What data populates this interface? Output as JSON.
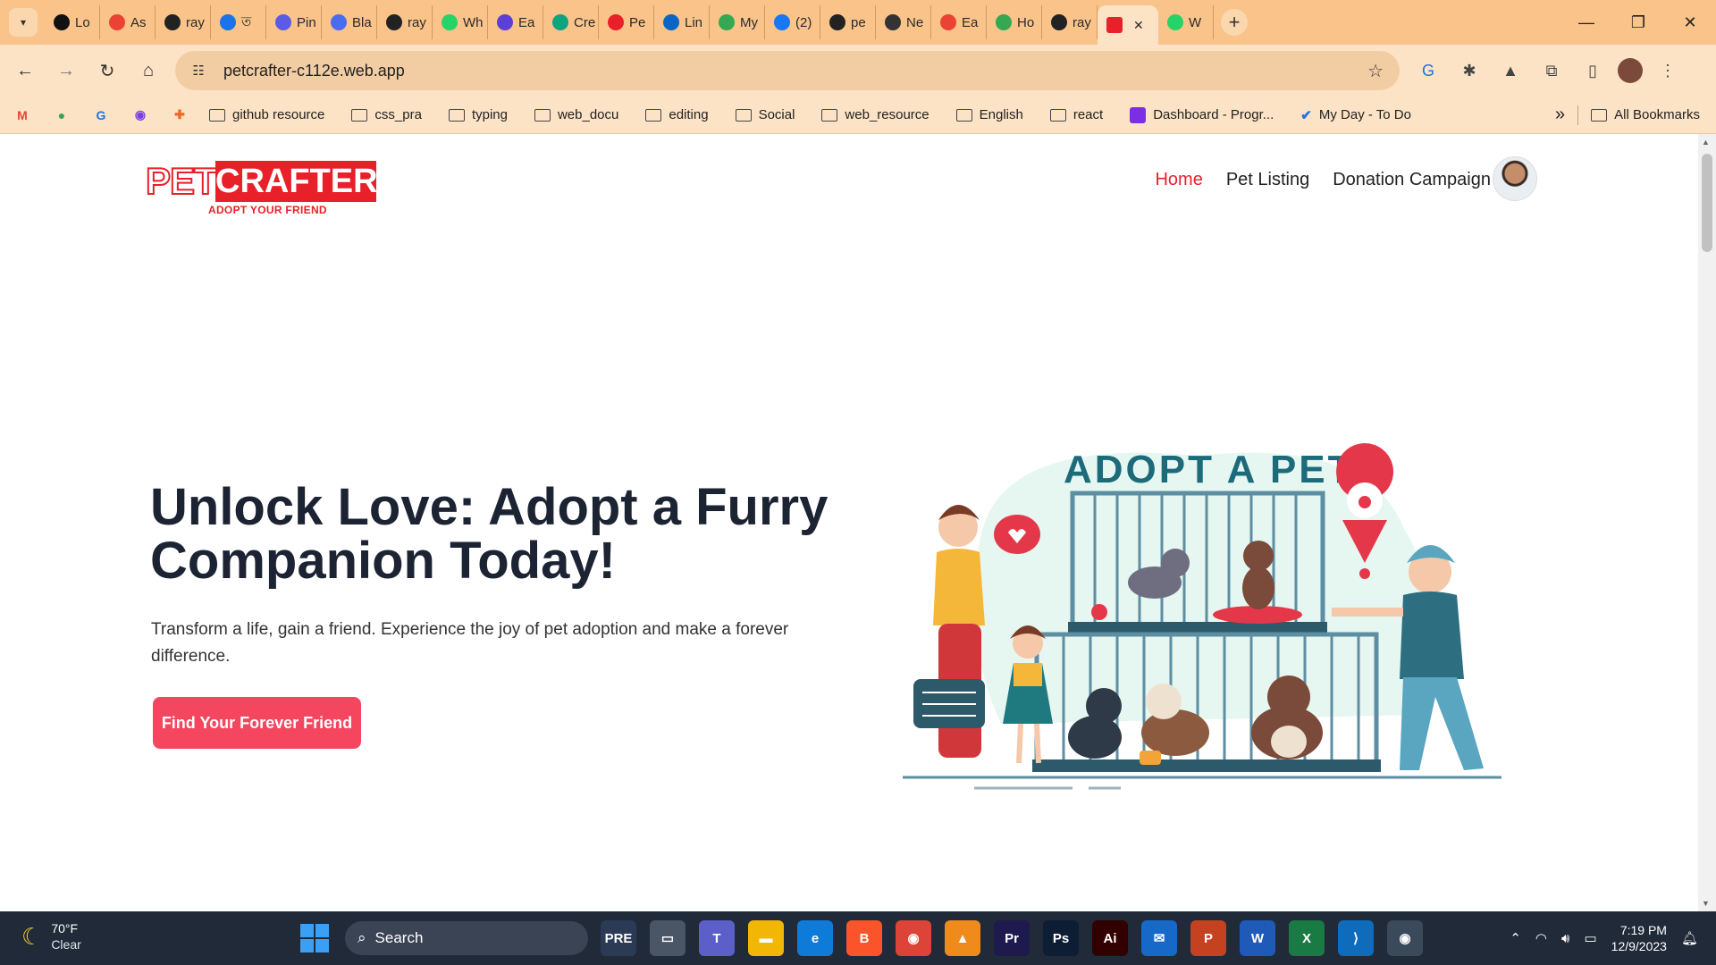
{
  "browser": {
    "tabs": [
      {
        "label": "Lo",
        "color": "#111111"
      },
      {
        "label": "As",
        "color": "#ea4335"
      },
      {
        "label": "ray",
        "color": "#222222"
      },
      {
        "label": "ত",
        "color": "#1a73e8"
      },
      {
        "label": "Pin",
        "color": "#5b5ce6"
      },
      {
        "label": "Bla",
        "color": "#4b6cf0"
      },
      {
        "label": "ray",
        "color": "#222222"
      },
      {
        "label": "Wh",
        "color": "#25d366"
      },
      {
        "label": "Ea",
        "color": "#5b3fd6"
      },
      {
        "label": "Cre",
        "color": "#10a37f"
      },
      {
        "label": "Pe",
        "color": "#e8202a"
      },
      {
        "label": "Lin",
        "color": "#0a66c2"
      },
      {
        "label": "My",
        "color": "#34a853"
      },
      {
        "label": "(2)",
        "color": "#1877f2"
      },
      {
        "label": "pe",
        "color": "#222222"
      },
      {
        "label": "Ne",
        "color": "#333333"
      },
      {
        "label": "Ea",
        "color": "#ea4335"
      },
      {
        "label": "Ho",
        "color": "#34a853"
      },
      {
        "label": "ray",
        "color": "#222222"
      }
    ],
    "active_tab": {
      "label": "",
      "close": "✕"
    },
    "last_tab": {
      "label": "W",
      "color": "#25d366"
    },
    "new_tab": "+",
    "url": "petcrafter-c112e.web.app",
    "bookmarks": [
      {
        "label": "github resource"
      },
      {
        "label": "css_pra"
      },
      {
        "label": "typing"
      },
      {
        "label": "web_docu"
      },
      {
        "label": "editing"
      },
      {
        "label": "Social"
      },
      {
        "label": "web_resource"
      },
      {
        "label": "English"
      },
      {
        "label": "react"
      }
    ],
    "bookmark_links": [
      {
        "label": "Dashboard - Progr..."
      },
      {
        "label": "My Day - To Do"
      }
    ],
    "more_bookmarks": "»",
    "all_bookmarks": "All Bookmarks"
  },
  "site": {
    "logo": {
      "pet": "PET",
      "crafter": "CRAFTER",
      "tagline": "ADOPT YOUR FRIEND"
    },
    "nav": [
      {
        "label": "Home",
        "active": true
      },
      {
        "label": "Pet Listing",
        "active": false
      },
      {
        "label": "Donation Campaign",
        "active": false
      }
    ],
    "hero": {
      "title": "Unlock Love: Adopt a Furry Companion Today!",
      "subtitle": "Transform a life, gain a friend. Experience the joy of pet adoption and make a forever difference.",
      "cta": "Find Your Forever Friend"
    },
    "illustration": {
      "heading": "ADOPT A PET"
    },
    "colors": {
      "accent": "#e8202a",
      "cta": "#f4475f",
      "heading": "#1c2434"
    }
  },
  "taskbar": {
    "weather": {
      "temp": "70°F",
      "condition": "Clear"
    },
    "search_label": "Search",
    "apps": [
      {
        "label": "PRE",
        "bg": "#2b3a55"
      },
      {
        "label": "▭",
        "bg": "#4a5566"
      },
      {
        "label": "T",
        "bg": "#5b5fc7"
      },
      {
        "label": "▬",
        "bg": "#f2b705"
      },
      {
        "label": "e",
        "bg": "#0f7bd8"
      },
      {
        "label": "B",
        "bg": "#fb542b"
      },
      {
        "label": "◉",
        "bg": "#db4437"
      },
      {
        "label": "▲",
        "bg": "#ef8a1d"
      },
      {
        "label": "Pr",
        "bg": "#1e1a4d"
      },
      {
        "label": "Ps",
        "bg": "#0d1d34"
      },
      {
        "label": "Ai",
        "bg": "#330000"
      },
      {
        "label": "✉",
        "bg": "#1769c8"
      },
      {
        "label": "P",
        "bg": "#c4421f"
      },
      {
        "label": "W",
        "bg": "#1f5ab8"
      },
      {
        "label": "X",
        "bg": "#1a7a44"
      },
      {
        "label": "⟩",
        "bg": "#0f6cbd"
      },
      {
        "label": "◉",
        "bg": "#3a4a5a"
      }
    ],
    "time": "7:19 PM",
    "date": "12/9/2023"
  }
}
